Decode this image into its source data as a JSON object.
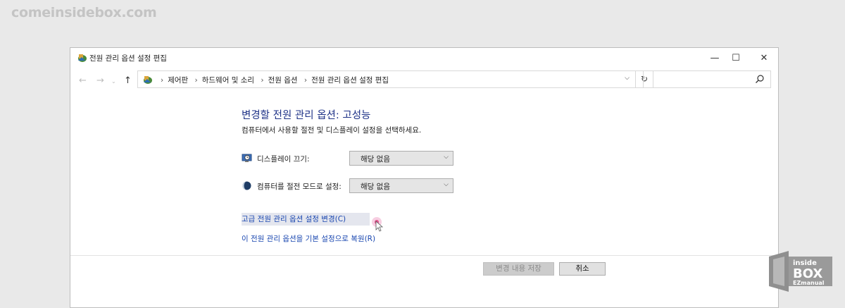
{
  "watermark": "comeinsidebox.com",
  "window": {
    "title": "전원 관리 옵션 설정 편집",
    "controls": {
      "minimize": "—",
      "maximize": "☐",
      "close": "✕"
    }
  },
  "address": {
    "crumbs": [
      "제어판",
      "하드웨어 및 소리",
      "전원 옵션",
      "전원 관리 옵션 설정 편집"
    ],
    "separator": "›",
    "dropdown_icon": "chevron-down-icon",
    "refresh_icon": "↻",
    "search_placeholder": ""
  },
  "main": {
    "heading": "변경할 전원 관리 옵션: 고성능",
    "subheading": "컴퓨터에서 사용할 절전 및 디스플레이 설정을 선택하세요.",
    "settings": [
      {
        "label": "디스플레이 끄기:",
        "value": "해당 없음",
        "icon": "monitor-clock-icon"
      },
      {
        "label": "컴퓨터를 절전 모드로 설정:",
        "value": "해당 없음",
        "icon": "moon-icon"
      }
    ],
    "links": {
      "advanced": "고급 전원 관리 옵션 설정 변경(C)",
      "restore": "이 전원 관리 옵션을 기본 설정으로 복원(R)"
    }
  },
  "buttons": {
    "save": "변경 내용 저장",
    "cancel": "취소"
  },
  "logo": {
    "line1": "inside",
    "line2": "BOX",
    "line3": "EZmanual"
  },
  "colors": {
    "heading": "#1e3287",
    "link": "#1a47b0",
    "background": "#e9e9e9"
  }
}
